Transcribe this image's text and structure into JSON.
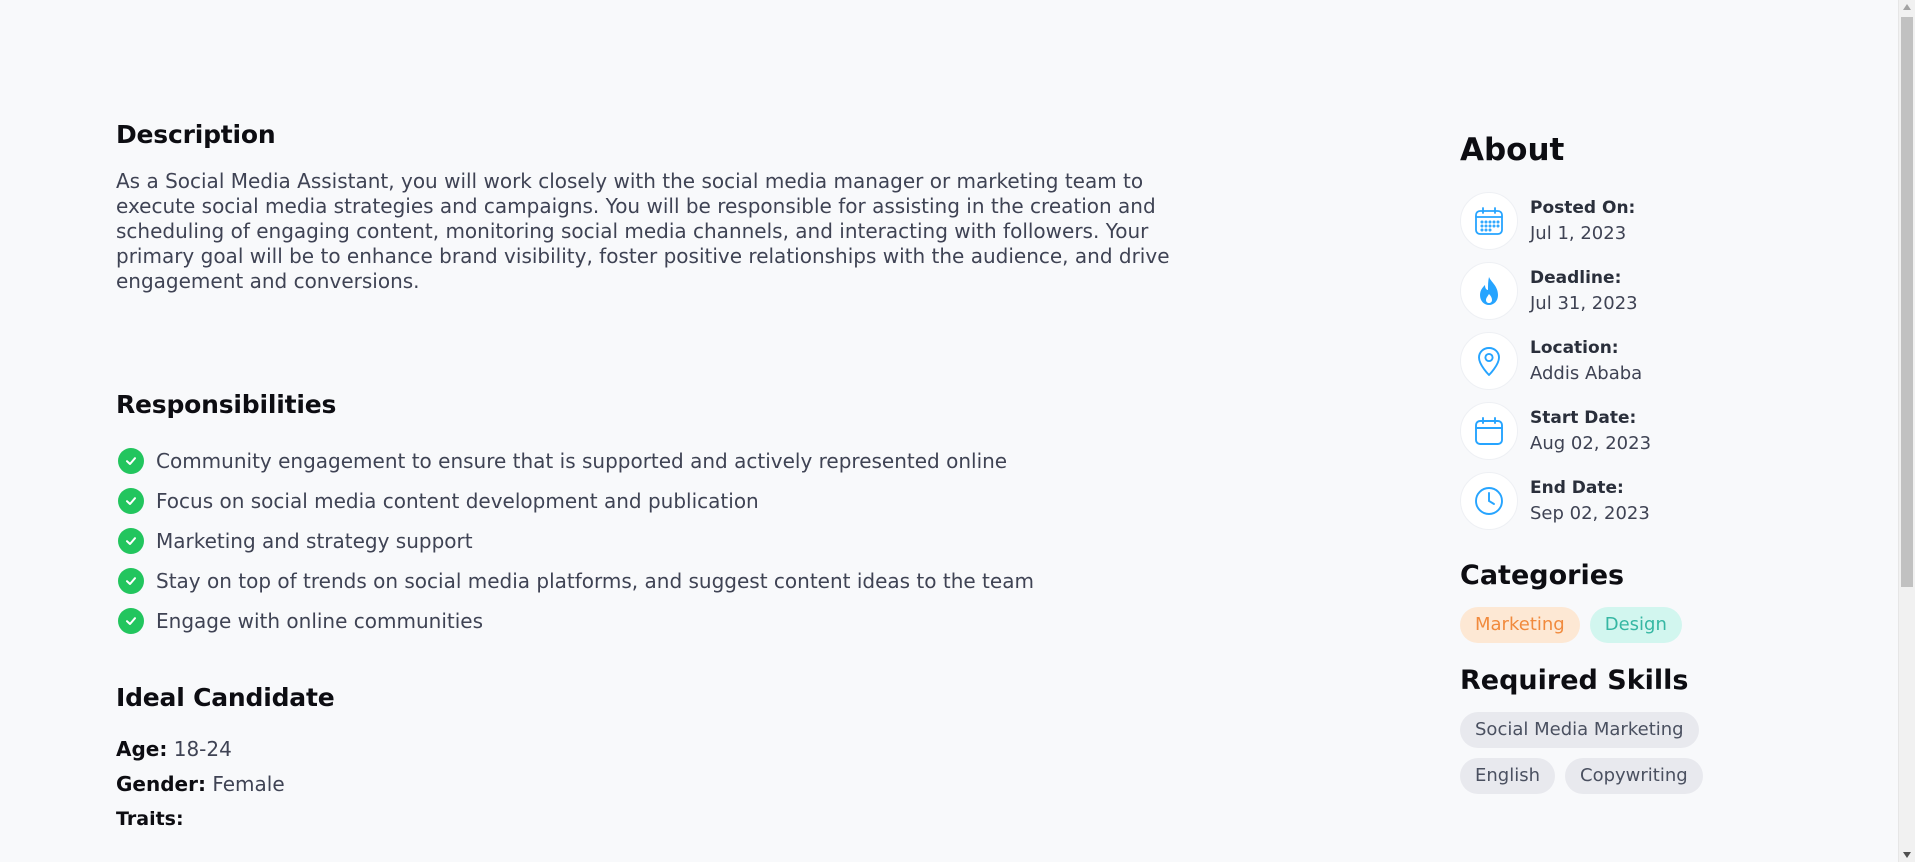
{
  "description": {
    "title": "Description",
    "text": "As a Social Media Assistant, you will work closely with the social media manager or marketing team to execute social media strategies and campaigns. You will be responsible for assisting in the creation and scheduling of engaging content, monitoring social media channels, and interacting with followers. Your primary goal will be to enhance brand visibility, foster positive relationships with the audience, and drive engagement and conversions."
  },
  "responsibilities": {
    "title": "Responsibilities",
    "items": [
      "Community engagement to ensure that is supported and actively represented online",
      "Focus on social media content development and publication",
      "Marketing and strategy support",
      "Stay on top of trends on social media platforms, and suggest content ideas to the team",
      "Engage with online communities"
    ]
  },
  "ideal_candidate": {
    "title": "Ideal Candidate",
    "age_label": "Age:",
    "age_value": "18-24",
    "gender_label": "Gender:",
    "gender_value": "Female",
    "traits_label": "Traits:"
  },
  "about": {
    "title": "About",
    "items": [
      {
        "icon": "calendar-grid-icon",
        "label": "Posted On:",
        "value": "Jul 1, 2023"
      },
      {
        "icon": "fire-icon",
        "label": "Deadline:",
        "value": "Jul 31, 2023"
      },
      {
        "icon": "location-pin-icon",
        "label": "Location:",
        "value": "Addis Ababa"
      },
      {
        "icon": "calendar-icon",
        "label": "Start Date:",
        "value": "Aug 02, 2023"
      },
      {
        "icon": "clock-icon",
        "label": "End Date:",
        "value": "Sep 02, 2023"
      }
    ]
  },
  "categories": {
    "title": "Categories",
    "items": [
      "Marketing",
      "Design"
    ]
  },
  "required_skills": {
    "title": "Required Skills",
    "items": [
      "Social Media Marketing",
      "English",
      "Copywriting"
    ]
  },
  "colors": {
    "accent": "#26a4ff",
    "check_green": "#22c55e",
    "marketing_bg": "#fde8d4",
    "marketing_text": "#f18a3d",
    "design_bg": "#d2f6ef",
    "design_text": "#36b7a3"
  }
}
